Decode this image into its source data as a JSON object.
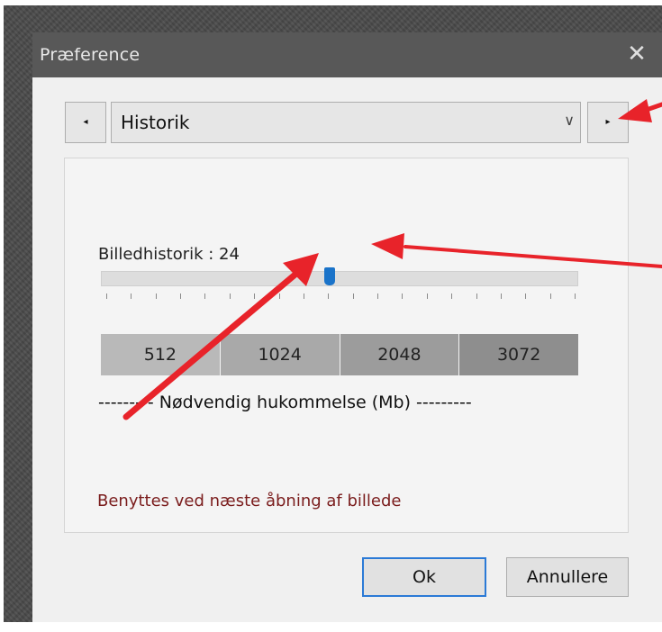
{
  "dialog": {
    "title": "Præference",
    "close_glyph": "✕"
  },
  "category_nav": {
    "prev_glyph": "◂",
    "next_glyph": "▸",
    "selected": "Historik",
    "chevron_glyph": "∨"
  },
  "history": {
    "label": "Billedhistorik : 24",
    "slider_fraction": 0.48,
    "tick_count": 20
  },
  "memory": {
    "values": [
      "512",
      "1024",
      "2048",
      "3072"
    ],
    "cell_colors": [
      "#b9b9b9",
      "#a9a9a9",
      "#9c9c9c",
      "#8e8e8e"
    ],
    "caption": "--------- Nødvendig hukommelse (Mb) ---------"
  },
  "info": {
    "text": "Benyttes ved næste åbning af billede",
    "color": "#7a1c1c"
  },
  "buttons": {
    "ok": "Ok",
    "cancel": "Annullere"
  },
  "colors": {
    "accent": "#2b7ad6",
    "thumb": "#1a73c9",
    "annotation_arrow": "#e8232a"
  }
}
